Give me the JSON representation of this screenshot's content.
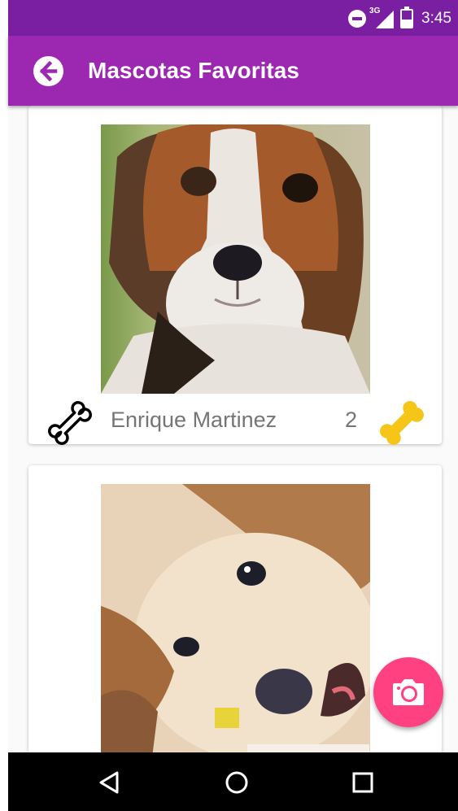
{
  "status_bar": {
    "time": "3:45",
    "network_label": "3G",
    "icons": [
      "do-not-disturb-icon",
      "signal-icon",
      "battery-icon"
    ]
  },
  "app_bar": {
    "title": "Mascotas Favoritas",
    "back_icon": "arrow-left-circle-icon",
    "color": "#9c27b0",
    "status_color": "#7b1fa2"
  },
  "cards": [
    {
      "photo": "beagle-puppy-photo",
      "owner": "Enrique Martinez",
      "likes": "2",
      "rate_icon": "bone-outline-icon",
      "like_icon": "bone-filled-icon"
    },
    {
      "photo": "puppy-photo"
    }
  ],
  "fab": {
    "icon": "camera-icon",
    "color": "#ff4081"
  },
  "nav_bar": {
    "icons": [
      "back-triangle-icon",
      "home-circle-icon",
      "recents-square-icon"
    ]
  },
  "colors": {
    "bone_filled": "#f5c518",
    "text_secondary": "#757575"
  }
}
